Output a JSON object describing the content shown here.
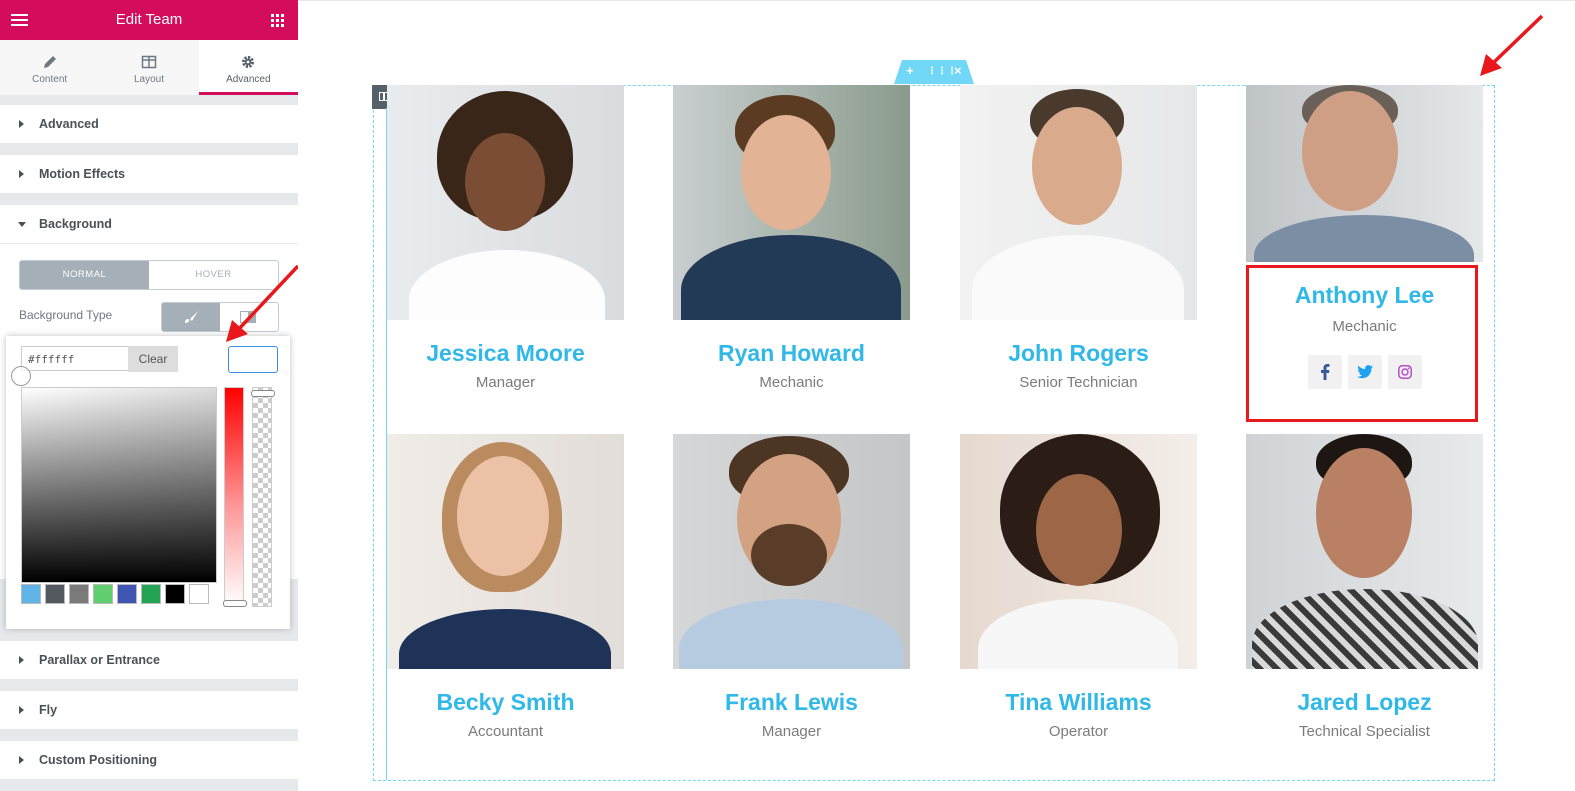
{
  "panel": {
    "title": "Edit Team",
    "tabs": [
      {
        "label": "Content",
        "active": false
      },
      {
        "label": "Layout",
        "active": false
      },
      {
        "label": "Advanced",
        "active": true
      }
    ],
    "sections": {
      "advanced": "Advanced",
      "motion": "Motion Effects",
      "background": "Background",
      "parallax": "Parallax or Entrance",
      "fly": "Fly",
      "custom": "Custom Positioning"
    },
    "background": {
      "normal": "NORMAL",
      "hover": "HOVER",
      "type_label": "Background Type"
    },
    "picker": {
      "hex_value": "#ffffff",
      "clear_label": "Clear",
      "swatches": [
        "#61b4e8",
        "#54595f",
        "#7a7a7a",
        "#61ce70",
        "#4054b2",
        "#23a455",
        "#000000",
        "#ffffff"
      ]
    }
  },
  "team": [
    {
      "name": "Jessica Moore",
      "role": "Manager"
    },
    {
      "name": "Ryan Howard",
      "role": "Mechanic"
    },
    {
      "name": "John Rogers",
      "role": "Senior Technician"
    },
    {
      "name": "Anthony Lee",
      "role": "Mechanic"
    },
    {
      "name": "Becky Smith",
      "role": "Accountant"
    },
    {
      "name": "Frank Lewis",
      "role": "Manager"
    },
    {
      "name": "Tina Williams",
      "role": "Operator"
    },
    {
      "name": "Jared Lopez",
      "role": "Technical Specialist"
    }
  ],
  "colors": {
    "brand": "#d30c5c",
    "accent": "#2fb8e8",
    "frame": "#71d7f7",
    "highlight": "#e8181c"
  }
}
